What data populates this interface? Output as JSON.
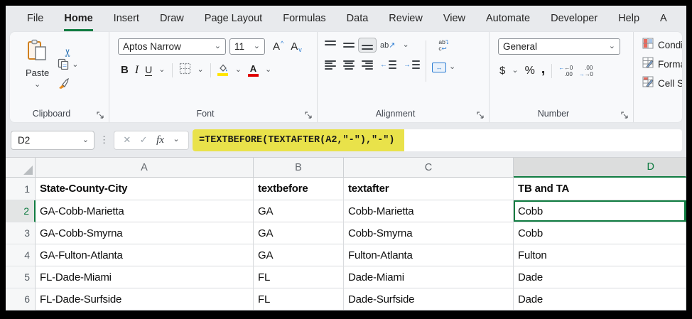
{
  "ribbon_tabs": {
    "items": [
      "File",
      "Home",
      "Insert",
      "Draw",
      "Page Layout",
      "Formulas",
      "Data",
      "Review",
      "View",
      "Automate",
      "Developer",
      "Help",
      "A"
    ],
    "active": "Home"
  },
  "ribbon": {
    "clipboard": {
      "label": "Clipboard",
      "paste": "Paste"
    },
    "font": {
      "label": "Font",
      "font_name": "Aptos Narrow",
      "font_size": "11"
    },
    "alignment": {
      "label": "Alignment"
    },
    "number": {
      "label": "Number",
      "format": "General"
    },
    "styles": {
      "items": [
        "Condit",
        "Format",
        "Cell St"
      ]
    }
  },
  "glyphs": {
    "cut": "✂",
    "bold": "B",
    "italic": "I",
    "underline": "U",
    "grow_font": "A",
    "shrink_font": "A",
    "font_color": "A",
    "orientation_ab": "ab",
    "wrap_ab": "ab",
    "wrap_c": "c",
    "fx": "fx",
    "dollar": "$",
    "percent": "%",
    "comma": ",",
    "inc_dec_top": "←0",
    "inc_dec_bot": ".00",
    "dec_dec_top": ".00",
    "dec_dec_bot": "→0"
  },
  "formula_bar": {
    "cell_reference": "D2",
    "formula": "=TEXTBEFORE(TEXTAFTER(A2,\"-\"),\"-\")"
  },
  "sheet": {
    "column_headers": [
      "A",
      "B",
      "C",
      "D"
    ],
    "selected_cell": "D2",
    "selected_column": "D",
    "selected_row": "2",
    "rows": [
      {
        "n": "1",
        "a": "State-County-City",
        "b": "textbefore",
        "c": "textafter",
        "d": "TB and TA"
      },
      {
        "n": "2",
        "a": "GA-Cobb-Marietta",
        "b": "GA",
        "c": "Cobb-Marietta",
        "d": "Cobb"
      },
      {
        "n": "3",
        "a": "GA-Cobb-Smyrna",
        "b": "GA",
        "c": "Cobb-Smyrna",
        "d": "Cobb"
      },
      {
        "n": "4",
        "a": "GA-Fulton-Atlanta",
        "b": "GA",
        "c": "Fulton-Atlanta",
        "d": "Fulton"
      },
      {
        "n": "5",
        "a": "FL-Dade-Miami",
        "b": "FL",
        "c": "Dade-Miami",
        "d": "Dade"
      },
      {
        "n": "6",
        "a": "FL-Dade-Surfside",
        "b": "FL",
        "c": "Dade-Surfside",
        "d": "Dade"
      }
    ]
  },
  "colors": {
    "accent_green": "#107C41",
    "formula_highlight": "#E9E24A",
    "fill_color_swatch": "#FFE400",
    "font_color_swatch": "#E00000"
  }
}
